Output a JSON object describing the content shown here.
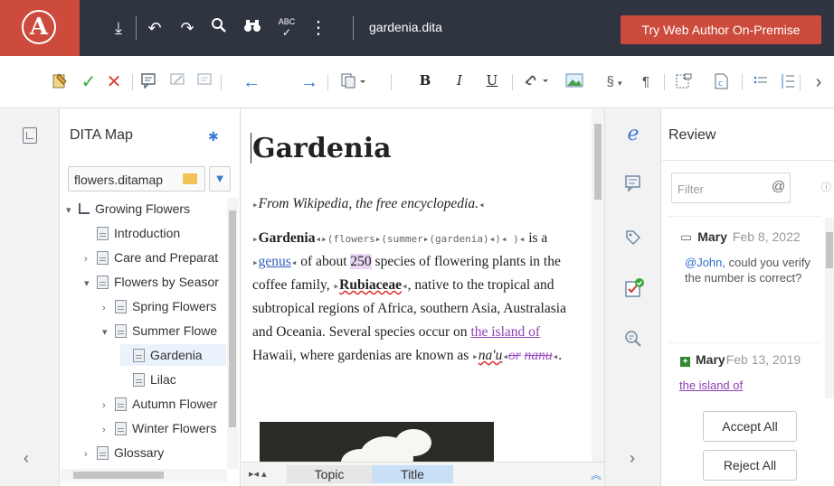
{
  "topbar": {
    "logo": "A",
    "filename": "gardenia.dita",
    "try_button": "Try Web Author On-Premise",
    "icons": [
      "download-icon",
      "undo-icon",
      "redo-icon",
      "search-icon",
      "binoculars-icon",
      "spellcheck-icon",
      "more-icon"
    ],
    "spellcheck_label": "ABC"
  },
  "toolbar": {
    "bold": "B",
    "italic": "I",
    "underline": "U",
    "section": "§",
    "paragraph": "¶",
    "icons": [
      "track-changes-icon",
      "accept-change-icon",
      "reject-change-icon",
      "add-comment-icon",
      "edit-comment-icon",
      "comment-icon",
      "prev-change-icon",
      "next-change-icon",
      "paste-icon",
      "bold-icon",
      "italic-icon",
      "underline-icon",
      "link-icon",
      "image-icon",
      "section-icon",
      "paragraph-icon",
      "insert-element-icon",
      "insert-conref-icon",
      "list-icon",
      "ordered-list-icon",
      "more-right-icon"
    ]
  },
  "map": {
    "title": "DITA Map",
    "selected_map": "flowers.ditamap",
    "tree": [
      {
        "label": "Growing Flowers",
        "level": 0,
        "caret": "▾",
        "kind": "map"
      },
      {
        "label": "Introduction",
        "level": 1,
        "caret": "",
        "kind": "topic"
      },
      {
        "label": "Care and Preparat",
        "level": 1,
        "caret": "›",
        "kind": "topic"
      },
      {
        "label": "Flowers by Seasor",
        "level": 1,
        "caret": "▾",
        "kind": "topic"
      },
      {
        "label": "Spring Flowers",
        "level": 2,
        "caret": "›",
        "kind": "topic"
      },
      {
        "label": "Summer Flowe",
        "level": 2,
        "caret": "▾",
        "kind": "topic"
      },
      {
        "label": "Gardenia",
        "level": 3,
        "caret": "",
        "kind": "topic",
        "selected": true
      },
      {
        "label": "Lilac",
        "level": 3,
        "caret": "",
        "kind": "topic"
      },
      {
        "label": "Autumn Flower",
        "level": 2,
        "caret": "›",
        "kind": "topic"
      },
      {
        "label": "Winter Flowers",
        "level": 2,
        "caret": "›",
        "kind": "topic"
      },
      {
        "label": "Glossary",
        "level": 1,
        "caret": "›",
        "kind": "topic"
      }
    ]
  },
  "editor": {
    "title": "Gardenia",
    "shortdesc": "From Wikipedia, the free encyclopedia.",
    "p1": {
      "term": "Gardenia",
      "tag_text": "(flowers",
      "tag_text2": "(summer",
      "tag_text3": "(gardenia)",
      "is_a": "is a",
      "genus": "genus",
      "of_about": "of about",
      "number": "250",
      "rest1": "species of flowering plants in the coffee family,",
      "family": "Rubiaceae",
      "rest2": ", native to the tropical and subtropical regions of Africa, southern Asia, Australasia and Oceania. Several species occur on",
      "inserted": "the island of",
      "rest3": "Hawaii, where gardenias are known as",
      "local_name": "na'u",
      "deleted": "or",
      "deleted_name": "nanu",
      "end": "."
    }
  },
  "breadcrumb": {
    "items": [
      "Topic",
      "Title"
    ]
  },
  "review": {
    "title": "Review",
    "filter_placeholder": "Filter",
    "at_symbol": "@",
    "info": "ⓘ",
    "cards": [
      {
        "user": "Mary",
        "date": "Feb 8, 2022",
        "mention": "@John",
        "text": ", could you verify the number is correct?"
      },
      {
        "user": "Mary",
        "date": "Feb 13, 2019",
        "change": "the island of"
      }
    ],
    "accept_all": "Accept All",
    "reject_all": "Reject All"
  },
  "colors": {
    "topbar_bg": "#2e3440",
    "brand_red": "#cc4b3c",
    "insert_purple": "#8e3fb3",
    "link_blue": "#2f5fbf"
  }
}
